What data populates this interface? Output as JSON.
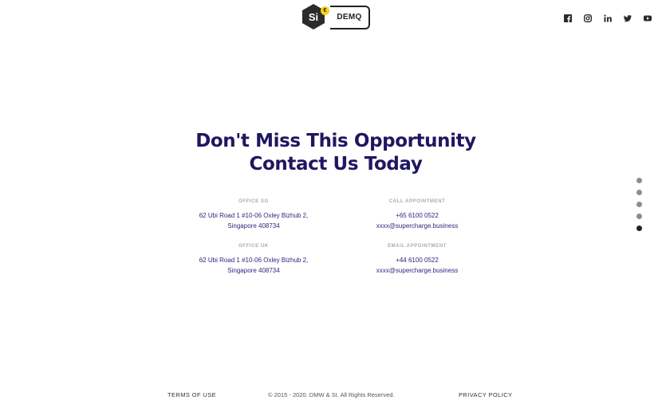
{
  "header": {
    "logo_mark": "Si",
    "logo_badge": "€",
    "logo_text": "DEMQ",
    "social_icons": [
      "facebook-icon",
      "instagram-icon",
      "linkedin-icon",
      "twitter-icon",
      "youtube-icon"
    ]
  },
  "main": {
    "headline_line1": "Don't Miss This Opportunity",
    "headline_line2": "Contact Us Today",
    "office_sg": {
      "label": "OFFICE SG",
      "line1": "62 Ubi Road 1 #10-06 Oxley Bizhub 2,",
      "line2": "Singapore 408734"
    },
    "call_appointment": {
      "label": "CALL APPOINTMENT",
      "phone": "+65 6100 0522",
      "email": "xxxx@supercharge.business"
    },
    "office_uk": {
      "label": "OFFICE UK",
      "line1": "62 Ubi Road 1 #10-06 Oxley Bizhub 2,",
      "line2": "Singapore 408734"
    },
    "email_appointment": {
      "label": "EMAIL APPOINTMENT",
      "phone": "+44 6100 0522",
      "email": "xxxx@supercharge.business"
    }
  },
  "side_nav": {
    "slide_count": 5,
    "active_index": 4
  },
  "footer": {
    "terms": "TERMS OF USE",
    "copyright": "© 2015 - 2020. DMW & SI. All Rights Reserved.",
    "privacy": "PRIVACY POLICY"
  },
  "colors": {
    "headline": "#1f1760",
    "link_text": "#2c2680",
    "label_gray": "#a9a9b3",
    "logo_accent": "#f5d417",
    "dot_active": "#222222",
    "dot_inactive": "#8d8d8d"
  }
}
